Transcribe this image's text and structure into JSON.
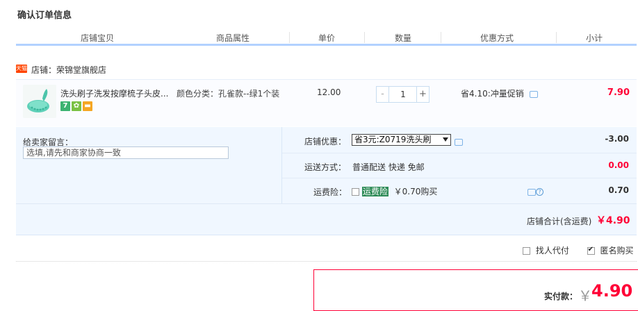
{
  "title": "确认订单信息",
  "columns": [
    "店铺宝贝",
    "商品属性",
    "单价",
    "数量",
    "优惠方式",
    "小计"
  ],
  "shop": {
    "badge": "天猫",
    "label": "店铺：荣锦堂旗舰店"
  },
  "item": {
    "name": "洗头刷子洗发按摩梳子头皮...",
    "badges": [
      "7",
      "",
      ""
    ],
    "attribute": "颜色分类：孔雀款--绿1个装",
    "price": "12.00",
    "quantity": "1",
    "qty_minus": "-",
    "qty_plus": "+",
    "promotion": "省4.10:冲量促销",
    "subtotal": "7.90"
  },
  "message": {
    "label": "给卖家留言：",
    "placeholder": "选填,请先和商家协商一致"
  },
  "options": {
    "shop_discount_label": "店铺优惠：",
    "shop_discount_selected": "省3元:Z0719洗头刷",
    "shop_discount_value": "-3.00",
    "shipping_label": "运送方式：",
    "shipping_text": "普通配送 快递 免邮",
    "shipping_value": "0.00",
    "insurance_label": "运费险：",
    "insurance_name": "运费险",
    "insurance_text": "￥0.70购买",
    "insurance_value": "0.70"
  },
  "shop_total": {
    "label": "店铺合计(含运费)",
    "value": "￥4.90"
  },
  "extras": {
    "proxy_pay": "找人代付",
    "anonymous": "匿名购买"
  },
  "payment": {
    "label": "实付款：",
    "yen": "￥",
    "amount": "4.90"
  },
  "colors": {
    "accent_red": "#ff0036",
    "header_line": "#b2d1ff",
    "options_bg": "#f0f7ff"
  },
  "icons": [
    "tmall-shop-icon",
    "product-thumbnail",
    "chat-icon",
    "help-icon",
    "dropdown-arrow-icon"
  ]
}
